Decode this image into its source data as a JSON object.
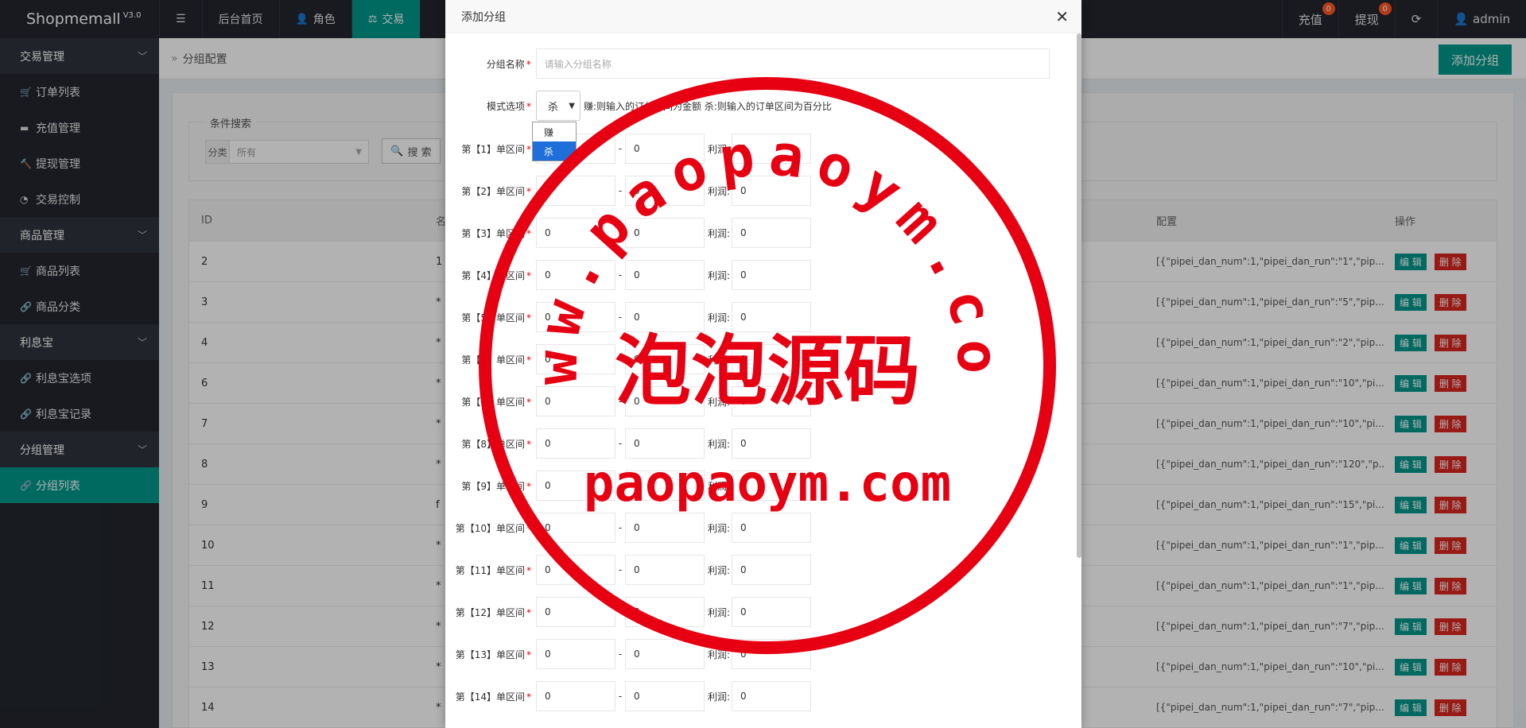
{
  "app": {
    "brand": "Shopmemall",
    "version": "V3.0"
  },
  "topnav": {
    "menu_icon": "menu-icon",
    "items": [
      {
        "label": "后台首页",
        "icon": ""
      },
      {
        "label": "角色",
        "icon": "user-icon"
      },
      {
        "label": "交易",
        "icon": "scale-icon",
        "active": true
      }
    ]
  },
  "topright": {
    "recharge": {
      "label": "充值",
      "count": "0"
    },
    "withdraw": {
      "label": "提现",
      "count": "0"
    },
    "refresh_icon": "refresh-icon",
    "user": "admin"
  },
  "sidebar": {
    "groups": [
      {
        "label": "交易管理",
        "items": [
          {
            "label": "订单列表",
            "icon": "cart-icon"
          },
          {
            "label": "充值管理",
            "icon": "card-icon"
          },
          {
            "label": "提现管理",
            "icon": "hammer-icon"
          },
          {
            "label": "交易控制",
            "icon": "gauge-icon"
          }
        ]
      },
      {
        "label": "商品管理",
        "items": [
          {
            "label": "商品列表",
            "icon": "cart-icon"
          },
          {
            "label": "商品分类",
            "icon": "link-icon"
          }
        ]
      },
      {
        "label": "利息宝",
        "items": [
          {
            "label": "利息宝选项",
            "icon": "link-icon"
          },
          {
            "label": "利息宝记录",
            "icon": "link-icon"
          }
        ]
      },
      {
        "label": "分组管理",
        "items": [
          {
            "label": "分组列表",
            "icon": "link-icon",
            "active": true
          }
        ]
      }
    ]
  },
  "breadcrumb": "分组配置",
  "add_group_button": "添加分组",
  "search": {
    "legend": "条件搜索",
    "filter_label": "分类",
    "filter_value": "所有",
    "button": "搜 索"
  },
  "table": {
    "headers": [
      "ID",
      "名",
      "配置",
      "操作"
    ],
    "rows": [
      {
        "id": "2",
        "name": "1",
        "config": "[{\"pipei_dan_num\":1,\"pipei_dan_run\":\"1\",\"pip..."
      },
      {
        "id": "3",
        "name": "*",
        "config": "[{\"pipei_dan_num\":1,\"pipei_dan_run\":\"5\",\"pip..."
      },
      {
        "id": "4",
        "name": "*",
        "config": "[{\"pipei_dan_num\":1,\"pipei_dan_run\":\"2\",\"pip..."
      },
      {
        "id": "6",
        "name": "*",
        "config": "[{\"pipei_dan_num\":1,\"pipei_dan_run\":\"10\",\"pi..."
      },
      {
        "id": "7",
        "name": "*",
        "config": "[{\"pipei_dan_num\":1,\"pipei_dan_run\":\"10\",\"pi..."
      },
      {
        "id": "8",
        "name": "*",
        "config": "[{\"pipei_dan_num\":1,\"pipei_dan_run\":\"120\",\"p..."
      },
      {
        "id": "9",
        "name": "f",
        "config": "[{\"pipei_dan_num\":1,\"pipei_dan_run\":\"15\",\"pi..."
      },
      {
        "id": "10",
        "name": "*",
        "config": "[{\"pipei_dan_num\":1,\"pipei_dan_run\":\"1\",\"pip..."
      },
      {
        "id": "11",
        "name": "*",
        "config": "[{\"pipei_dan_num\":1,\"pipei_dan_run\":\"1\",\"pip..."
      },
      {
        "id": "12",
        "name": "*",
        "config": "[{\"pipei_dan_num\":1,\"pipei_dan_run\":\"7\",\"pip..."
      },
      {
        "id": "13",
        "name": "*",
        "config": "[{\"pipei_dan_num\":1,\"pipei_dan_run\":\"10\",\"pi..."
      },
      {
        "id": "14",
        "name": "*",
        "config": "[{\"pipei_dan_num\":1,\"pipei_dan_run\":\"7\",\"pip..."
      }
    ],
    "edit_label": "编 辑",
    "delete_label": "删 除"
  },
  "modal": {
    "title": "添加分组",
    "close_icon": "close-icon",
    "name_label": "分组名称",
    "name_placeholder": "请输入分组名称",
    "mode_label": "模式选项",
    "mode_value": "杀",
    "mode_hint": "赚:则输入的订单区间为金额 杀:则输入的订单区间为百分比",
    "mode_options": [
      "赚",
      "杀"
    ],
    "profit_label": "利润:",
    "ranges": [
      {
        "label": "第【1】单区间",
        "from": "0",
        "to": "0",
        "profit": "0"
      },
      {
        "label": "第【2】单区间",
        "from": "0",
        "to": "0",
        "profit": "0"
      },
      {
        "label": "第【3】单区间",
        "from": "0",
        "to": "0",
        "profit": "0"
      },
      {
        "label": "第【4】单区间",
        "from": "0",
        "to": "0",
        "profit": "0"
      },
      {
        "label": "第【5】单区间",
        "from": "0",
        "to": "0",
        "profit": "0"
      },
      {
        "label": "第【6】单区间",
        "from": "0",
        "to": "0",
        "profit": "0"
      },
      {
        "label": "第【7】单区间",
        "from": "0",
        "to": "0",
        "profit": "0"
      },
      {
        "label": "第【8】单区间",
        "from": "0",
        "to": "0",
        "profit": "0"
      },
      {
        "label": "第【9】单区间",
        "from": "0",
        "to": "0",
        "profit": "0"
      },
      {
        "label": "第【10】单区间",
        "from": "0",
        "to": "0",
        "profit": "0"
      },
      {
        "label": "第【11】单区间",
        "from": "0",
        "to": "0",
        "profit": "0"
      },
      {
        "label": "第【12】单区间",
        "from": "0",
        "to": "0",
        "profit": "0"
      },
      {
        "label": "第【13】单区间",
        "from": "0",
        "to": "0",
        "profit": "0"
      },
      {
        "label": "第【14】单区间",
        "from": "0",
        "to": "0",
        "profit": "0"
      }
    ]
  },
  "watermark": {
    "ring_text": "www.paopaoym.com",
    "center_text": "泡泡源码",
    "bottom_text": "paopaoym.com",
    "color": "#e60012"
  },
  "colors": {
    "accent": "#00988b",
    "danger": "#d8261f",
    "dark": "#23262e"
  }
}
